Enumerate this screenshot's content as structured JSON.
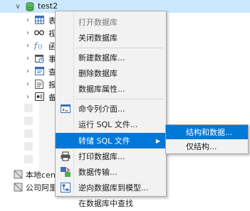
{
  "tree": {
    "db_name": "test2",
    "children": [
      {
        "icon": "table-icon",
        "label": "表"
      },
      {
        "icon": "view-icon",
        "label": "视"
      },
      {
        "icon": "function-icon",
        "label": "函"
      },
      {
        "icon": "event-icon",
        "label": "事"
      },
      {
        "icon": "query-icon",
        "label": "查"
      },
      {
        "icon": "report-icon",
        "label": "报"
      },
      {
        "icon": "backup-icon",
        "label": "备"
      }
    ],
    "connections": [
      {
        "label": "本地cen"
      },
      {
        "label": "公司阿里"
      }
    ]
  },
  "context_menu": {
    "items": [
      {
        "label": "打开数据库",
        "disabled": true
      },
      {
        "label": "关闭数据库"
      },
      {
        "label": "新建数据库..."
      },
      {
        "label": "删除数据库"
      },
      {
        "label": "数据库属性..."
      },
      {
        "label": "命令列介面...",
        "icon": "console-icon"
      },
      {
        "label": "运行 SQL 文件..."
      },
      {
        "label": "转储 SQL 文件",
        "highlighted": true,
        "has_submenu": true
      },
      {
        "label": "打印数据库...",
        "icon": "printer-icon"
      },
      {
        "label": "数据传输...",
        "icon": "transfer-icon"
      },
      {
        "label": "逆向数据库到模型...",
        "icon": "model-icon"
      },
      {
        "label": "在数据库中查找"
      }
    ]
  },
  "submenu": {
    "items": [
      {
        "label": "结构和数据...",
        "highlighted": true
      },
      {
        "label": "仅结构..."
      }
    ]
  },
  "colors": {
    "accent": "#0078d7",
    "selection": "#cce8ff",
    "db_green": "#3a9a3a"
  }
}
